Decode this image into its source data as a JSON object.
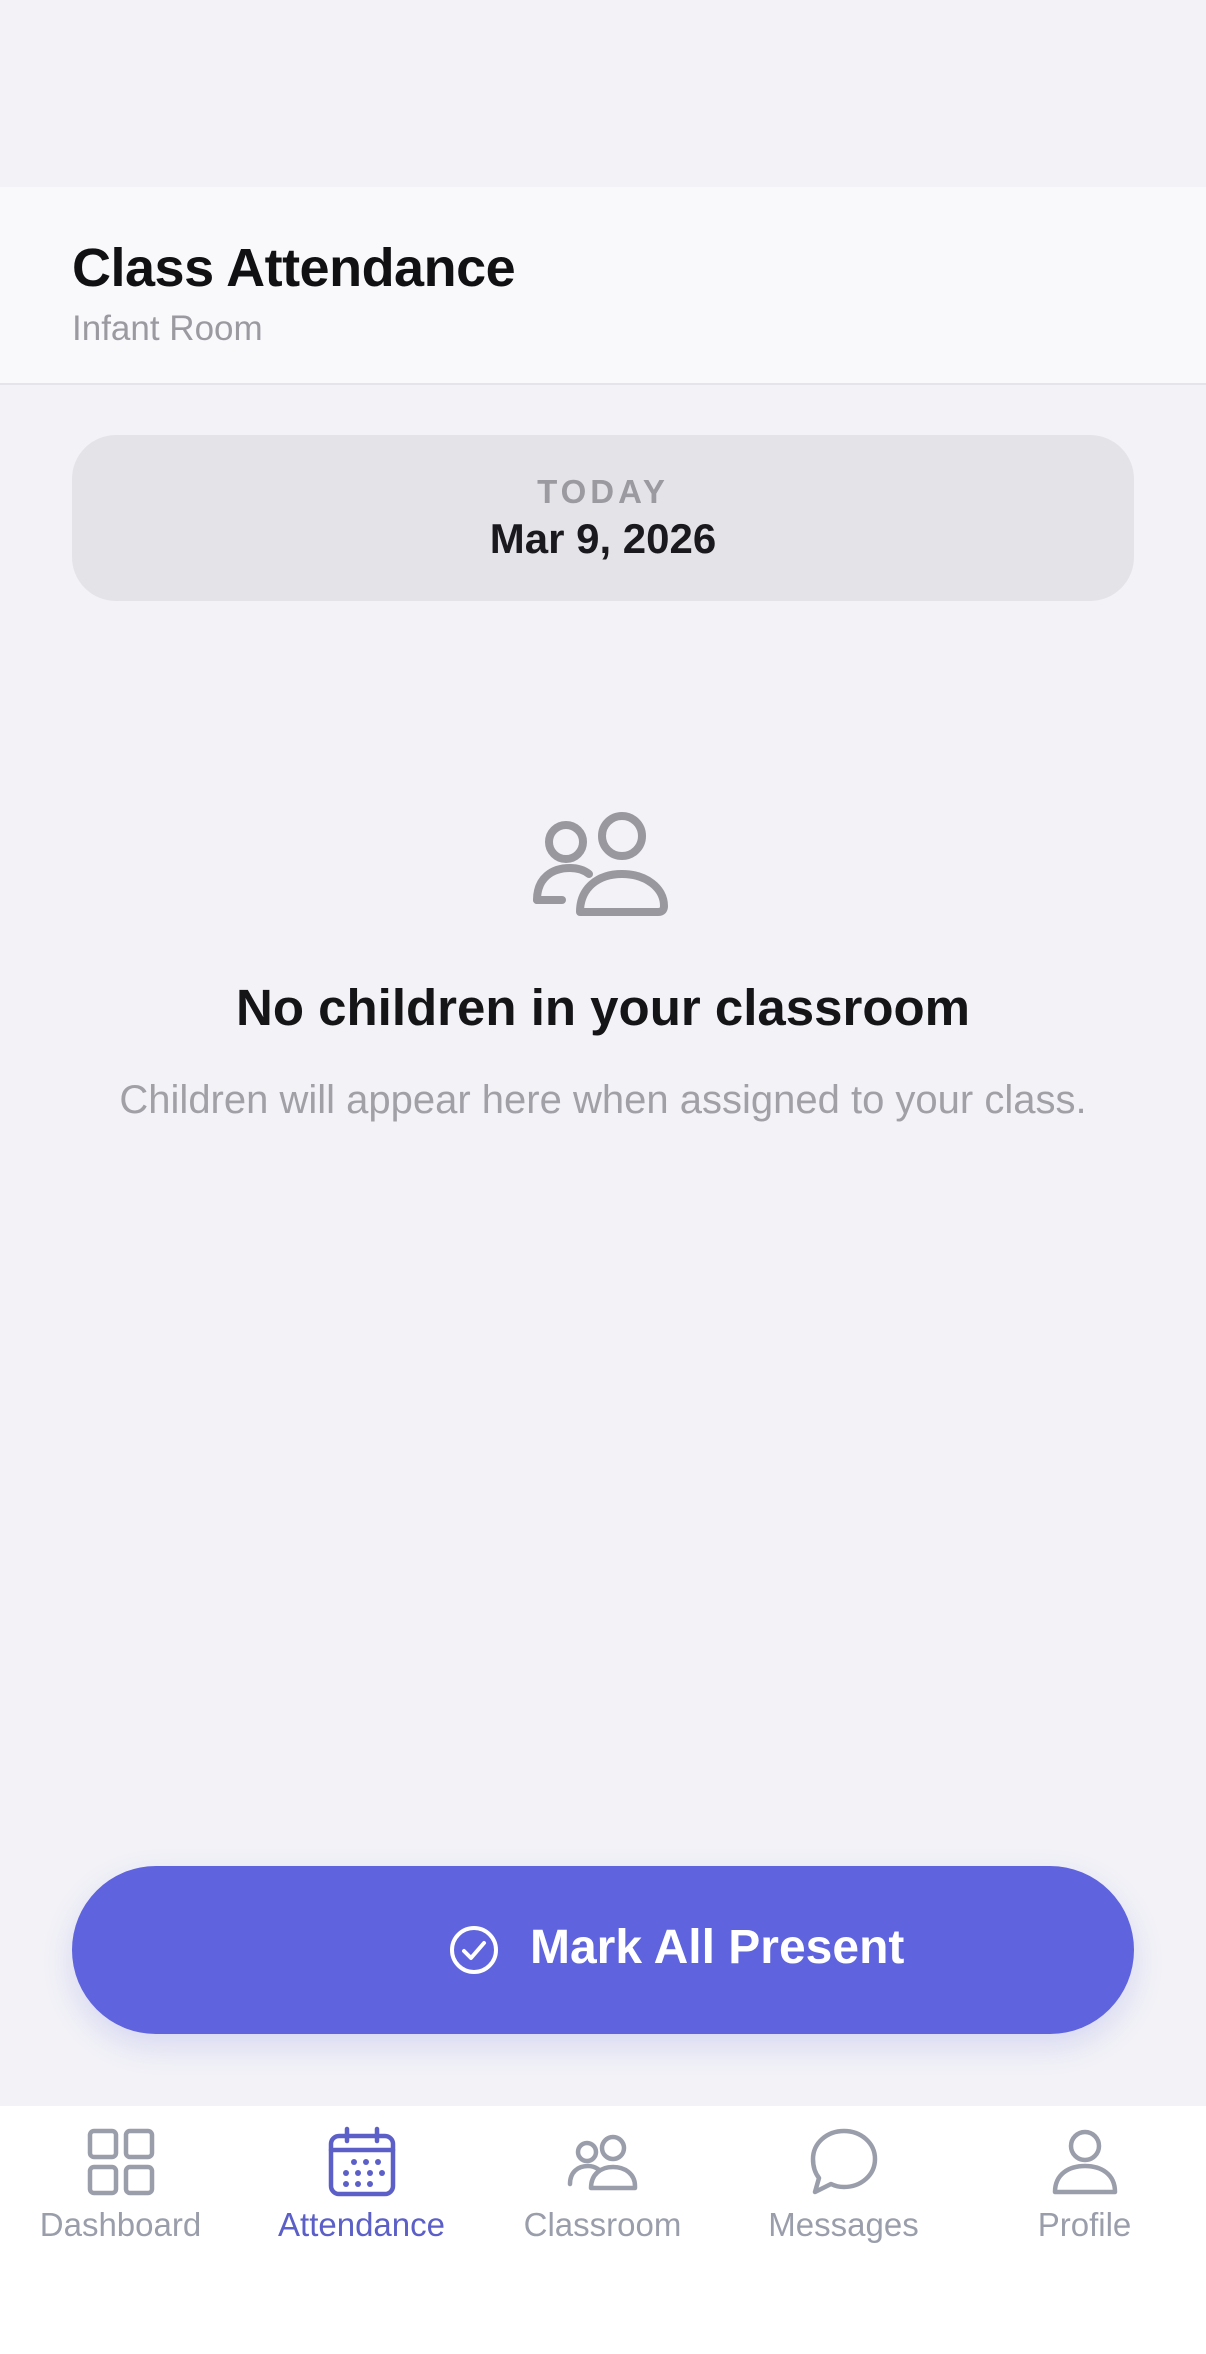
{
  "header": {
    "title": "Class Attendance",
    "subtitle": "Infant Room"
  },
  "date_card": {
    "eyebrow": "TODAY",
    "date": "Mar 9, 2026"
  },
  "empty_state": {
    "icon": "users-icon",
    "title": "No children in your classroom",
    "message": "Children will appear here when assigned to your class."
  },
  "primary_action": {
    "label": "Mark All Present",
    "icon": "check-circle-icon",
    "color": "#5f63dd"
  },
  "tabbar": {
    "active": "Attendance",
    "active_color": "#5b5fc7",
    "inactive_color": "#9a9eab",
    "items": [
      {
        "label": "Dashboard",
        "icon": "grid-icon"
      },
      {
        "label": "Attendance",
        "icon": "calendar-icon"
      },
      {
        "label": "Classroom",
        "icon": "users-icon"
      },
      {
        "label": "Messages",
        "icon": "chat-bubble-icon"
      },
      {
        "label": "Profile",
        "icon": "user-icon"
      }
    ]
  }
}
